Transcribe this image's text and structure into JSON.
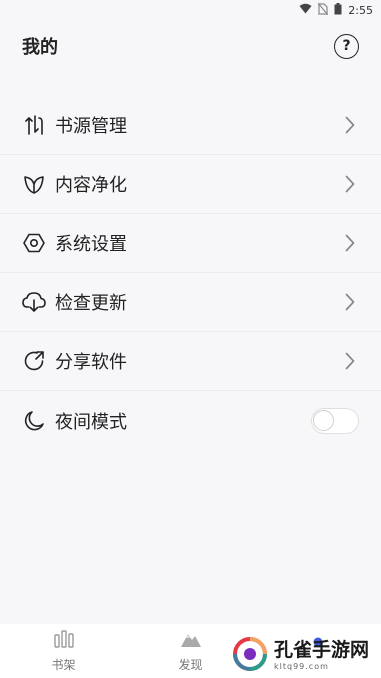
{
  "status_bar": {
    "time": "2:55"
  },
  "header": {
    "title": "我的",
    "help_label": "?"
  },
  "menu": {
    "items": [
      {
        "label": "书源管理",
        "icon": "source-arrows-icon"
      },
      {
        "label": "内容净化",
        "icon": "leaf-icon"
      },
      {
        "label": "系统设置",
        "icon": "hexagon-settings-icon"
      },
      {
        "label": "检查更新",
        "icon": "cloud-download-icon"
      },
      {
        "label": "分享软件",
        "icon": "share-refresh-icon"
      },
      {
        "label": "夜间模式",
        "icon": "moon-icon"
      }
    ],
    "night_mode_enabled": false
  },
  "bottom_nav": {
    "items": [
      {
        "label": "书架",
        "icon": "bookshelf-icon"
      },
      {
        "label": "发现",
        "icon": "mountain-icon"
      },
      {
        "label": "",
        "icon": "dot-icon"
      }
    ]
  },
  "watermark": {
    "text": "孔雀手游网",
    "sub": "kltq99.com"
  },
  "colors": {
    "accent": "#3b5bdb",
    "background": "#f7f7f9"
  }
}
